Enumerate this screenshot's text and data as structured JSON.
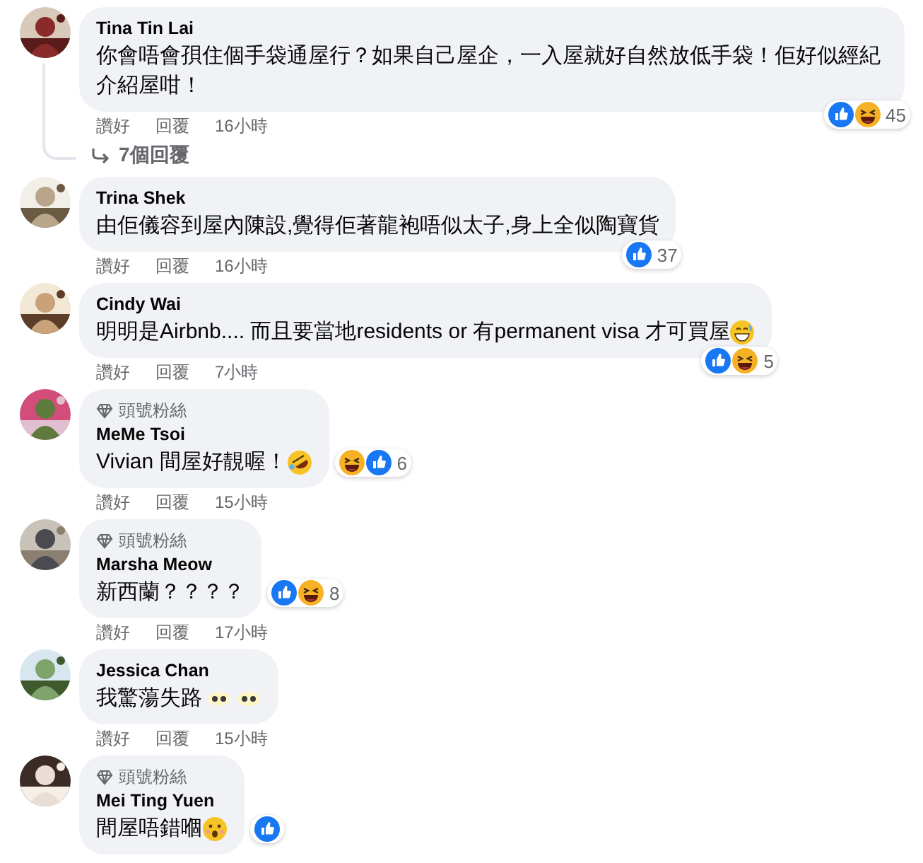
{
  "comments": [
    {
      "author": "Tina Tin Lai",
      "text": "你會唔會孭住個手袋通屋行？如果自己屋企，一入屋就好自然放低手袋！佢好似經紀介紹屋咁！",
      "actions": [
        "讚好",
        "回覆",
        "16小時"
      ],
      "reactions": [
        {
          "kind": "like"
        },
        {
          "kind": "haha"
        }
      ],
      "reaction_count": "45",
      "replies": "7個回覆"
    },
    {
      "author": "Trina Shek",
      "text": "由佢儀容到屋內陳設,覺得佢著龍袍唔似太子,身上全似陶寶貨",
      "actions": [
        "讚好",
        "回覆",
        "16小時"
      ],
      "reactions": [
        {
          "kind": "like"
        }
      ],
      "reaction_count": "37"
    },
    {
      "author": "Cindy Wai",
      "text": "明明是Airbnb.... 而且要當地residents or 有permanent visa 才可買屋",
      "emoji": {
        "kind": "grin"
      },
      "actions": [
        "讚好",
        "回覆",
        "7小時"
      ],
      "reactions": [
        {
          "kind": "like"
        },
        {
          "kind": "haha"
        }
      ],
      "reaction_count": "5"
    },
    {
      "badge": "頭號粉絲",
      "author": "MeMe Tsoi",
      "text": "Vivian 間屋好靚喔！",
      "emoji": {
        "kind": "rofl"
      },
      "actions": [
        "讚好",
        "回覆",
        "15小時"
      ],
      "reactions": [
        {
          "kind": "haha"
        },
        {
          "kind": "like"
        }
      ],
      "reaction_count": "6"
    },
    {
      "badge": "頭號粉絲",
      "author": "Marsha Meow",
      "text": "新西蘭？？？？",
      "actions": [
        "讚好",
        "回覆",
        "17小時"
      ],
      "reactions": [
        {
          "kind": "like"
        },
        {
          "kind": "haha"
        }
      ],
      "reaction_count": "8"
    },
    {
      "author": "Jessica Chan",
      "text": "我驚蕩失路",
      "emoji": {
        "kind": "eyes"
      },
      "actions": [
        "讚好",
        "回覆",
        "15小時"
      ]
    },
    {
      "badge": "頭號粉絲",
      "author": "Mei Ting Yuen",
      "text": "間屋唔錯嗰",
      "emoji": {
        "kind": "wow"
      },
      "reactions": [
        {
          "kind": "like"
        }
      ]
    }
  ]
}
